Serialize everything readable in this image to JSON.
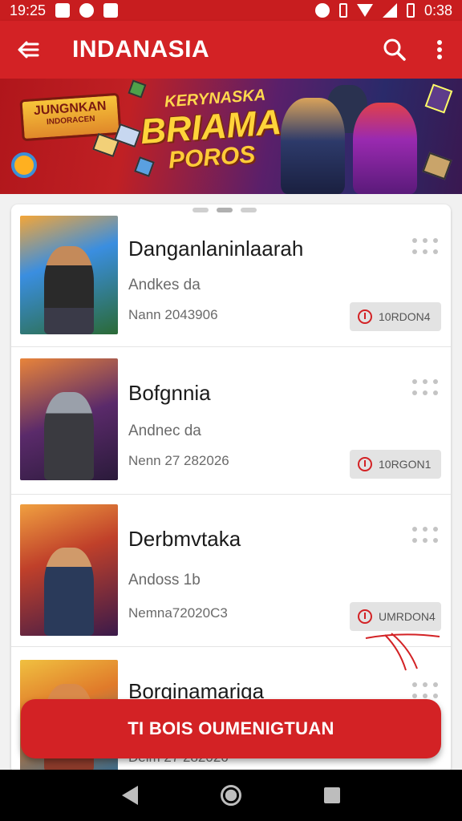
{
  "status_bar": {
    "time": "19:25",
    "battery_time": "0:38"
  },
  "app_bar": {
    "title": "INDANASIA"
  },
  "banner": {
    "logo_text": "JUNGNKAN",
    "logo_sub": "INDORACEN",
    "subtitle": "KERYNASKA",
    "title": "BRIAMA",
    "tagline": "POROS",
    "slides": 3,
    "active_slide": 2
  },
  "list": {
    "items": [
      {
        "title": "Danganlaninlaarah",
        "subtitle": "Andkes da",
        "date": "Nann 2043906",
        "badge": "10RDON4"
      },
      {
        "title": "Bofgnnia",
        "subtitle": "Andnec da",
        "date": "Nenn 27 282026",
        "badge": "10RGON1"
      },
      {
        "title": "Derbmvtaka",
        "subtitle": "Andoss 1b",
        "date": "Nemna72020C3",
        "badge": "UMRDON4"
      },
      {
        "title": "Borginamariga",
        "subtitle": "",
        "date": "Deim 27 282026",
        "badge": ""
      }
    ]
  },
  "fab": {
    "label": "TI BOIS OUMENIGTUAN"
  },
  "colors": {
    "primary": "#d32225",
    "status_bar": "#c81d1f"
  }
}
